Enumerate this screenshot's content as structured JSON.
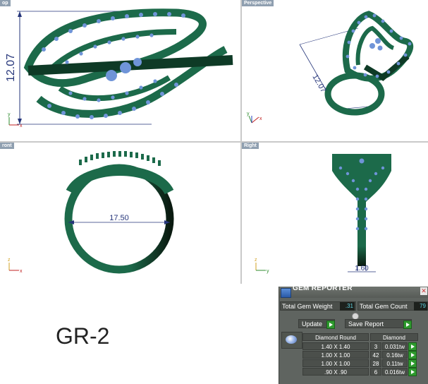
{
  "viewports": {
    "top": {
      "label": "op",
      "dimension": "12.07"
    },
    "perspective": {
      "label": "Perspective",
      "dimension": "12.07"
    },
    "front": {
      "label": "ront",
      "dimension": "17.50"
    },
    "right": {
      "label": "Right",
      "dimension": "1.60"
    }
  },
  "axes": {
    "x": "x",
    "y": "y",
    "z": "z"
  },
  "model_label": "GR-2",
  "colors": {
    "metal": "#1c6a4a",
    "metal_dark": "#0e3a26",
    "gem": "#7a9ee0",
    "dimension": "#25357a"
  },
  "gem_reporter": {
    "title": "GEM REPORTER",
    "total_weight_label": "Total Gem Weight",
    "total_weight_value": ".31",
    "total_count_label": "Total Gem Count",
    "total_count_value": "79",
    "update_label": "Update",
    "save_report_label": "Save Report",
    "columns": [
      "Diamond Round",
      "Diamond"
    ],
    "rows": [
      {
        "size": "1.40 X 1.40",
        "count": "3",
        "weight": "0.031tw"
      },
      {
        "size": "1.00 X 1.00",
        "count": "42",
        "weight": "0.16tw"
      },
      {
        "size": "1.00 X 1.00",
        "count": "28",
        "weight": "0.11tw"
      },
      {
        "size": ".90 X .90",
        "count": "6",
        "weight": "0.016tw"
      }
    ]
  }
}
